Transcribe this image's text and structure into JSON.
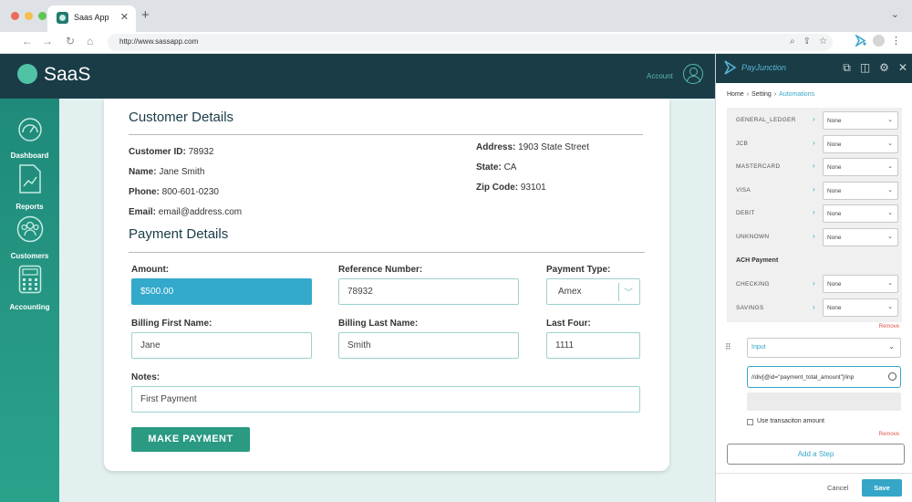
{
  "browser": {
    "tab_title": "Saas App",
    "url": "http://www.sassapp.com",
    "dot_colors": [
      "#ed6a5e",
      "#f4bf4f",
      "#61c554"
    ]
  },
  "app": {
    "logo": "SaaS",
    "account_label": "Account",
    "brand_color": "#1a3c47",
    "accent_color": "#2a9a82"
  },
  "sidebar": {
    "items": [
      {
        "label": "Dashboard",
        "icon": "gauge-icon"
      },
      {
        "label": "Reports",
        "icon": "document-chart-icon"
      },
      {
        "label": "Customers",
        "icon": "people-icon"
      },
      {
        "label": "Accounting",
        "icon": "calculator-icon"
      }
    ]
  },
  "customer": {
    "title": "Customer Details",
    "id_label": "Customer ID:",
    "id_value": "78932",
    "name_label": "Name:",
    "name_value": "Jane Smith",
    "phone_label": "Phone:",
    "phone_value": "800-601-0230",
    "email_label": "Email:",
    "email_value": "email@address.com",
    "address_label": "Address:",
    "address_value": "1903 State Street",
    "state_label": "State:",
    "state_value": "CA",
    "zip_label": "Zip Code:",
    "zip_value": "93101"
  },
  "payment": {
    "title": "Payment Details",
    "amount_label": "Amount:",
    "amount_value": "$500.00",
    "reference_label": "Reference Number:",
    "reference_value": "78932",
    "type_label": "Payment Type:",
    "type_value": "Amex",
    "first_label": "Billing First Name:",
    "first_value": "Jane",
    "last_label": "Billing Last Name:",
    "last_value": "Smith",
    "four_label": "Last Four:",
    "four_value": "1111",
    "notes_label": "Notes:",
    "notes_value": "First Payment",
    "submit_label": "MAKE PAYMENT"
  },
  "panel": {
    "brand": "PayJunction",
    "breadcrumb": [
      "Home",
      "Setting",
      "Automations"
    ],
    "card_rows": [
      {
        "label": "GENERAL_LEDGER",
        "value": "None"
      },
      {
        "label": "JCB",
        "value": "None"
      },
      {
        "label": "MASTERCARD",
        "value": "None"
      },
      {
        "label": "VISA",
        "value": "None"
      },
      {
        "label": "DEBIT",
        "value": "None"
      },
      {
        "label": "UNKNOWN",
        "value": "None"
      }
    ],
    "ach_heading": "ACH Payment",
    "ach_rows": [
      {
        "label": "CHECKING",
        "value": "None"
      },
      {
        "label": "SAVINGS",
        "value": "None"
      }
    ],
    "remove_label": "Remove",
    "step_type": "Input",
    "step_xpath": "//div[@id=\"payment_total_amount\"]/inp",
    "use_amount_label": "Use transaciton amount",
    "add_step_label": "Add a Step",
    "cancel_label": "Cancel",
    "save_label": "Save"
  }
}
